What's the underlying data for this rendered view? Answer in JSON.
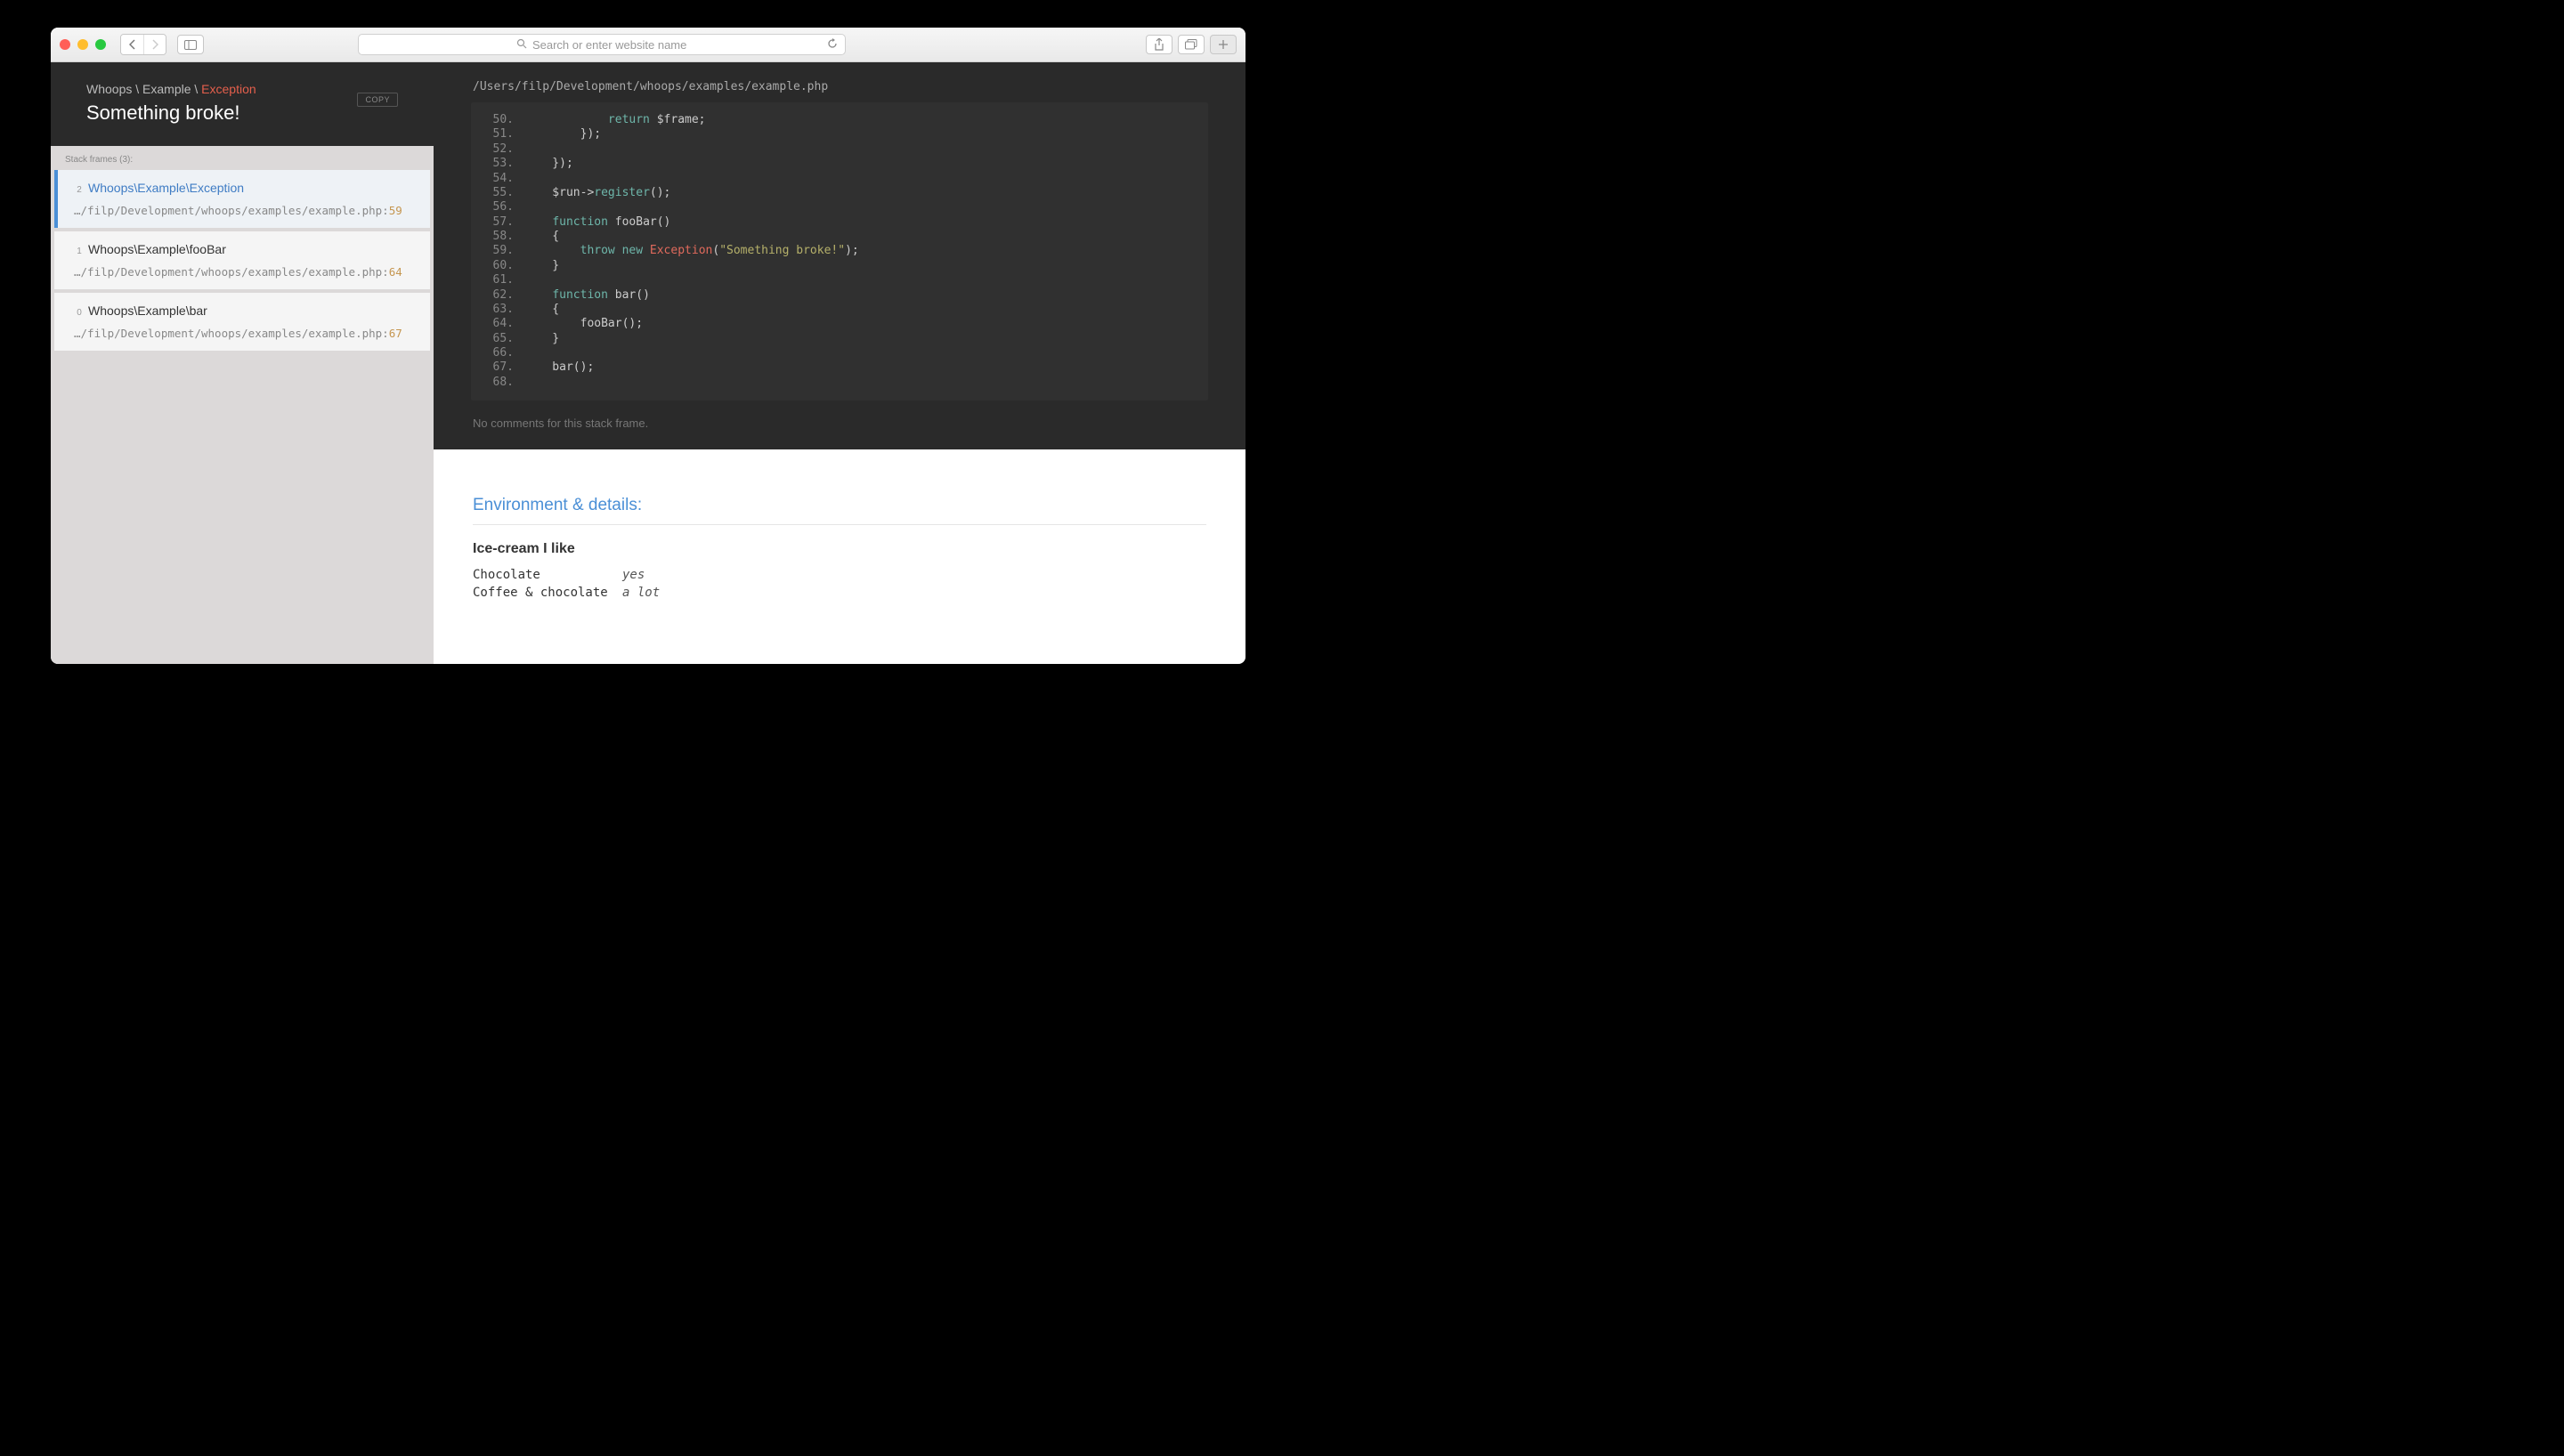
{
  "browser": {
    "placeholder": "Search or enter website name"
  },
  "exception": {
    "namespace": "Whoops \\ Example \\ ",
    "class": "Exception",
    "message": "Something broke!",
    "copy_label": "COPY"
  },
  "stack": {
    "label": "Stack frames (3):",
    "frames": [
      {
        "num": "2",
        "title": "Whoops\\Example\\Exception",
        "path": "…/filp/Development/whoops/examples/example.php",
        "line": "59",
        "active": true
      },
      {
        "num": "1",
        "title": "Whoops\\Example\\fooBar",
        "path": "…/filp/Development/whoops/examples/example.php",
        "line": "64",
        "active": false
      },
      {
        "num": "0",
        "title": "Whoops\\Example\\bar",
        "path": "…/filp/Development/whoops/examples/example.php",
        "line": "67",
        "active": false
      }
    ]
  },
  "file": {
    "path": "/Users/filp/Development/whoops/examples/example.php",
    "no_comments": "No comments for this stack frame."
  },
  "code": {
    "lines": [
      {
        "n": "50.",
        "html": "            <span class='tok-kw'>return</span> $frame;"
      },
      {
        "n": "51.",
        "html": "        });"
      },
      {
        "n": "52.",
        "html": ""
      },
      {
        "n": "53.",
        "html": "    });"
      },
      {
        "n": "54.",
        "html": ""
      },
      {
        "n": "55.",
        "html": "    $run-><span class='tok-fn'>register</span>();"
      },
      {
        "n": "56.",
        "html": ""
      },
      {
        "n": "57.",
        "html": "    <span class='tok-kw'>function</span> fooBar<span>()</span>"
      },
      {
        "n": "58.",
        "html": "    {"
      },
      {
        "n": "59.",
        "html": "        <span class='tok-kw'>throw</span> <span class='tok-new'>new</span> <span class='tok-err'>Exception</span>(<span class='tok-str'>\"Something broke!\"</span>);"
      },
      {
        "n": "60.",
        "html": "    }"
      },
      {
        "n": "61.",
        "html": ""
      },
      {
        "n": "62.",
        "html": "    <span class='tok-kw'>function</span> bar<span>()</span>"
      },
      {
        "n": "63.",
        "html": "    {"
      },
      {
        "n": "64.",
        "html": "        fooBar();"
      },
      {
        "n": "65.",
        "html": "    }"
      },
      {
        "n": "66.",
        "html": ""
      },
      {
        "n": "67.",
        "html": "    bar();"
      },
      {
        "n": "68.",
        "html": ""
      }
    ]
  },
  "details": {
    "heading": "Environment & details:",
    "sub_heading": "Ice-cream I like",
    "rows": [
      {
        "key": "Chocolate",
        "val": "yes"
      },
      {
        "key": "Coffee & chocolate",
        "val": "a lot"
      }
    ]
  }
}
